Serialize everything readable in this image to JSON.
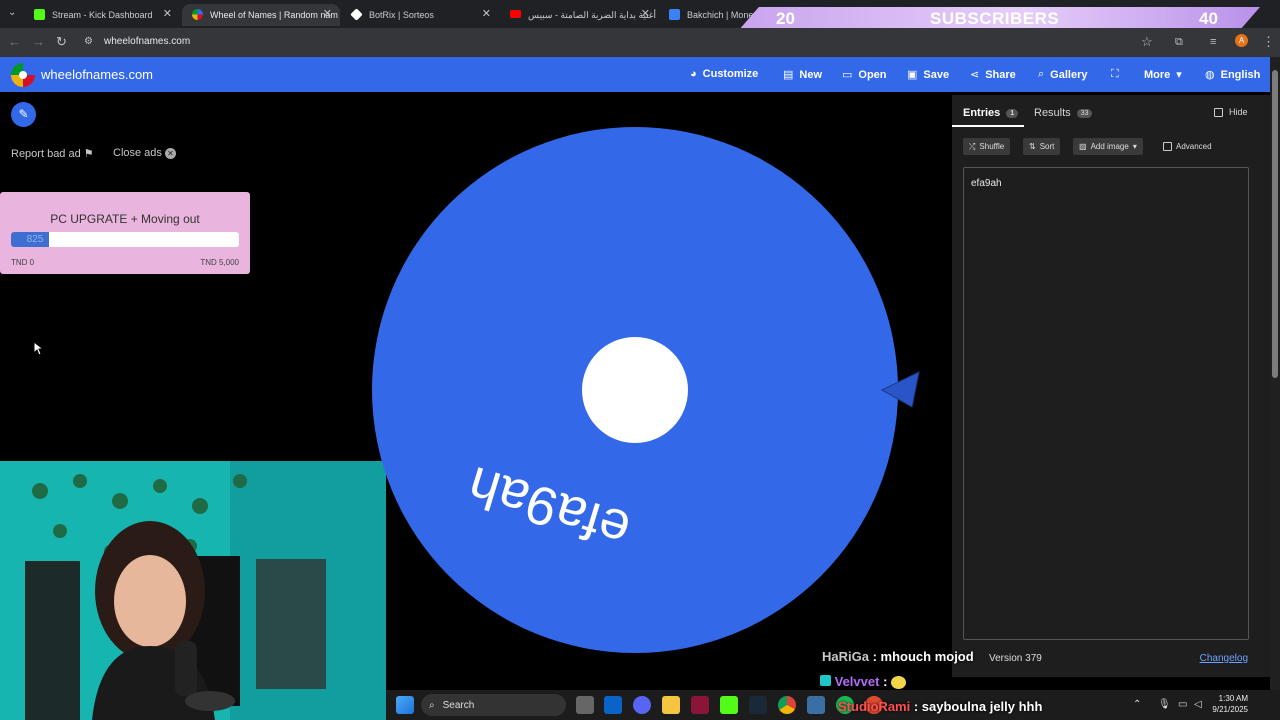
{
  "browser": {
    "tabs": [
      {
        "label": "Stream - Kick Dashboard",
        "color": "#53fc18"
      },
      {
        "label": "Wheel of Names | Random nam",
        "color": "#3369e8"
      },
      {
        "label": "BotRix | Sorteos",
        "color": "#ffffff"
      },
      {
        "label": "أغنية بداية الضربة الصامتة - سبيس",
        "color": "#ff0000"
      },
      {
        "label": "Bakchich | Monetiz",
        "color": "#3b82f6"
      }
    ],
    "url": "wheelofnames.com",
    "profile_initial": "A"
  },
  "overlay": {
    "left_number": "20",
    "label": "SUBSCRIBERS",
    "right_number": "40"
  },
  "navbar": {
    "site_name": "wheelofnames.com",
    "items": [
      {
        "label": "Customize",
        "icon": "palette-icon"
      },
      {
        "label": "New",
        "icon": "file-icon"
      },
      {
        "label": "Open",
        "icon": "folder-icon"
      },
      {
        "label": "Save",
        "icon": "save-icon"
      },
      {
        "label": "Share",
        "icon": "share-icon"
      },
      {
        "label": "Gallery",
        "icon": "search-icon"
      },
      {
        "label": "",
        "icon": "fullscreen-icon"
      },
      {
        "label": "More",
        "icon": "chevron-down-icon"
      },
      {
        "label": "English",
        "icon": "globe-icon"
      }
    ]
  },
  "left_panel": {
    "report_ad": "Report bad ad",
    "close_ads": "Close ads",
    "goal": {
      "title": "PC UPGRATE + Moving out",
      "current": "825",
      "min_label": "TND 0",
      "max_label": "TND 5,000",
      "fraction": 0.165,
      "fill_color": "#3e6fd0"
    }
  },
  "wheel": {
    "entry": "efa9ah",
    "color": "#3369e8"
  },
  "right_panel": {
    "tabs": [
      {
        "label": "Entries",
        "badge": "1"
      },
      {
        "label": "Results",
        "badge": "33"
      }
    ],
    "hide_label": "Hide",
    "buttons": {
      "shuffle": "Shuffle",
      "sort": "Sort",
      "add_image": "Add image",
      "advanced": "Advanced"
    },
    "entries_text": "efa9ah",
    "version": "Version 379",
    "changelog": "Changelog"
  },
  "chat": [
    {
      "user": "HaRiGa",
      "message": "mhouch mojod",
      "color": "#c8c8c8"
    },
    {
      "user": "Velvvet",
      "message": "",
      "color": "#b26cf5"
    },
    {
      "user": "StudioRami",
      "message": "sayboulna jelly hhh",
      "color": "#ff5050"
    }
  ],
  "taskbar": {
    "search_label": "Search",
    "time": "1:30 AM",
    "date": "9/21/2025"
  }
}
